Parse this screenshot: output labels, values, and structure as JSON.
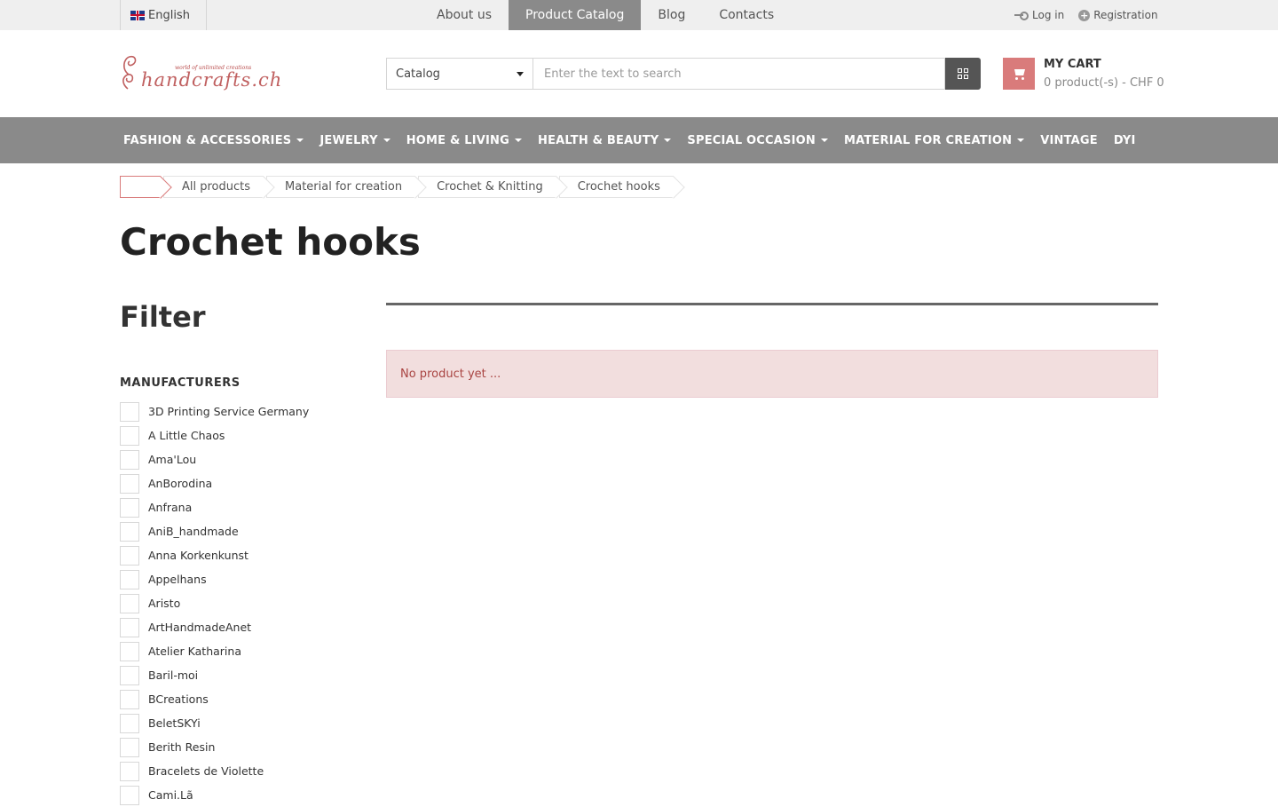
{
  "topbar": {
    "language": "English",
    "language_caret": "",
    "nav": [
      "About us",
      "Product Catalog",
      "Blog",
      "Contacts"
    ],
    "active_nav": "Product Catalog",
    "login": "Log in",
    "registration": "Registration"
  },
  "logo": {
    "name": "handcrafts.ch",
    "tagline": "world of unlimited creations"
  },
  "search": {
    "category": "Catalog",
    "placeholder": "Enter the text to search"
  },
  "cart": {
    "title": "MY CART",
    "summary": "0 product(-s) - CHF 0"
  },
  "main_nav": {
    "items": [
      {
        "label": "FASHION & ACCESSORIES",
        "dropdown": true
      },
      {
        "label": "JEWELRY",
        "dropdown": true
      },
      {
        "label": "HOME & LIVING",
        "dropdown": true
      },
      {
        "label": "HEALTH & BEAUTY",
        "dropdown": true
      },
      {
        "label": "SPECIAL OCCASION",
        "dropdown": true
      },
      {
        "label": "MATERIAL FOR CREATION",
        "dropdown": true
      },
      {
        "label": "VINTAGE",
        "dropdown": false
      },
      {
        "label": "DYI",
        "dropdown": false
      }
    ]
  },
  "breadcrumb": {
    "home_glyph": "",
    "items": [
      "All products",
      "Material for creation",
      "Crochet & Knitting",
      "Crochet hooks"
    ]
  },
  "page": {
    "title": "Crochet hooks"
  },
  "filter": {
    "title": "Filter",
    "manufacturers_heading": "MANUFACTURERS",
    "manufacturers": [
      "3D Printing Service Germany",
      "A Little Chaos",
      "Ama'Lou",
      "AnBorodina",
      "Anfrana",
      "AniB_handmade",
      "Anna Korkenkunst",
      "Appelhans",
      "Aristo",
      "ArtHandmadeAnet",
      "Atelier Katharina",
      "Baril-moi",
      "BCreations",
      "BeletSKYi",
      "Berith Resin",
      "Bracelets de Violette",
      "Cami.Lã"
    ]
  },
  "content": {
    "empty_message": "No product yet ..."
  },
  "colors": {
    "accent": "#d97b7b",
    "nav_bg": "#8a8a8a",
    "alert_bg": "#f2dede",
    "alert_text": "#a94442"
  }
}
